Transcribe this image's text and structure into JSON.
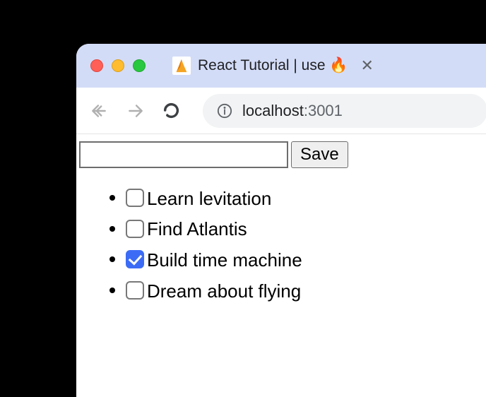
{
  "tab": {
    "title": "React Tutorial | use 🔥"
  },
  "address": {
    "host": "localhost",
    "port": ":3001"
  },
  "form": {
    "input_value": "",
    "save_label": "Save"
  },
  "todos": [
    {
      "label": "Learn levitation",
      "checked": false
    },
    {
      "label": "Find Atlantis",
      "checked": false
    },
    {
      "label": "Build time machine",
      "checked": true
    },
    {
      "label": "Dream about flying",
      "checked": false
    }
  ]
}
